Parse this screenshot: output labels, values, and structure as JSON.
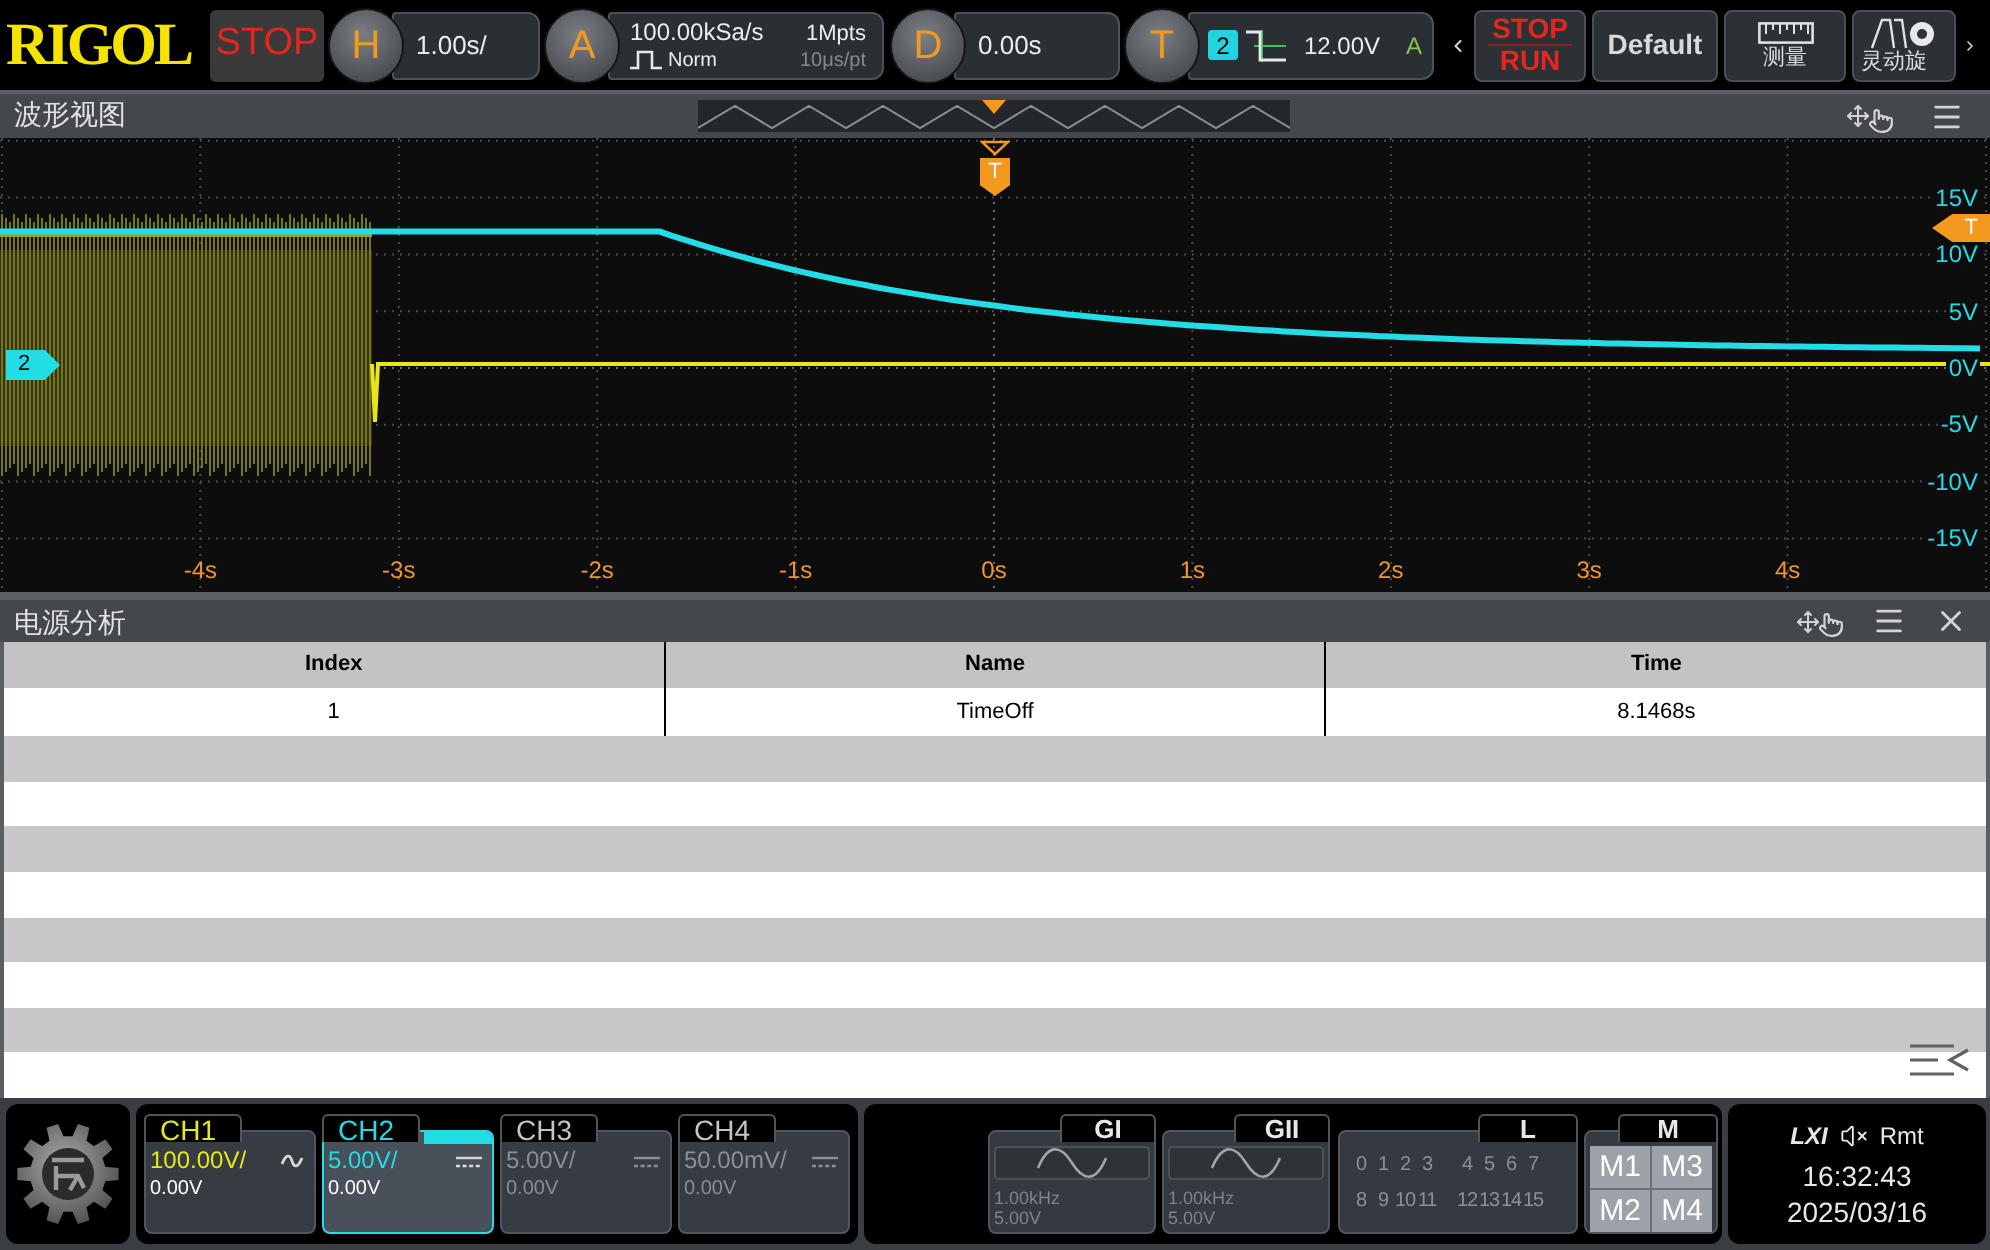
{
  "top_bar": {
    "logo": "RIGOL",
    "run_status": "STOP",
    "horizontal": {
      "label": "H",
      "scale": "1.00s/"
    },
    "acquire": {
      "label": "A",
      "sample_rate": "100.00kSa/s",
      "memory_depth": "1Mpts",
      "mode": "Norm",
      "resolution": "10μs/pt"
    },
    "delay": {
      "label": "D",
      "value": "0.00s"
    },
    "trigger": {
      "label": "T",
      "source": "2",
      "level": "12.00V",
      "sweep": "A"
    },
    "buttons": [
      {
        "kind": "run_stop",
        "lines": [
          "STOP",
          "RUN"
        ]
      },
      {
        "kind": "default",
        "label": "Default"
      },
      {
        "kind": "measure",
        "label": "测量"
      },
      {
        "kind": "knob",
        "label": "灵动旋"
      }
    ]
  },
  "waveform_window": {
    "title": "波形视图",
    "channel_marker": "2",
    "trigger_position_marker": "T",
    "trigger_level_marker": "T",
    "y_labels": [
      "15V",
      "10V",
      "5V",
      "0V",
      "-5V",
      "-10V",
      "-15V"
    ],
    "x_labels": [
      "-4s",
      "-3s",
      "-2s",
      "-1s",
      "0s",
      "1s",
      "2s",
      "3s",
      "4s"
    ]
  },
  "analysis_window": {
    "title": "电源分析",
    "table": {
      "columns": [
        "Index",
        "Name",
        "Time"
      ],
      "rows": [
        [
          "1",
          "TimeOff",
          "8.1468s"
        ]
      ]
    }
  },
  "bottom_bar": {
    "channels": [
      {
        "label": "CH1",
        "scale": "100.00V/",
        "offset": "0.00V",
        "ac_coupled": true,
        "on": true,
        "selected": false,
        "color": "#e6e619"
      },
      {
        "label": "CH2",
        "scale": "5.00V/",
        "offset": "0.00V",
        "ac_coupled": false,
        "on": true,
        "selected": true,
        "color": "#22dce6"
      },
      {
        "label": "CH3",
        "scale": "5.00V/",
        "offset": "0.00V",
        "ac_coupled": false,
        "on": false,
        "selected": false
      },
      {
        "label": "CH4",
        "scale": "50.00mV/",
        "offset": "0.00V",
        "ac_coupled": false,
        "on": false,
        "selected": false
      }
    ],
    "generators": [
      {
        "label": "GI",
        "frequency": "1.00kHz",
        "amplitude": "5.00V",
        "on": false
      },
      {
        "label": "GII",
        "frequency": "1.00kHz",
        "amplitude": "5.00V",
        "on": false
      }
    ],
    "logic": {
      "label": "L",
      "channels": [
        "0",
        "1",
        "2",
        "3",
        "4",
        "5",
        "6",
        "7",
        "8",
        "9",
        "10",
        "11",
        "12",
        "13",
        "14",
        "15"
      ]
    },
    "math": {
      "label": "M",
      "items": [
        "M1",
        "M3",
        "M2",
        "M4"
      ]
    },
    "status": {
      "lxi": "LXI",
      "muted": true,
      "remote": "Rmt",
      "time": "16:32:43",
      "date": "2025/03/16"
    }
  }
}
